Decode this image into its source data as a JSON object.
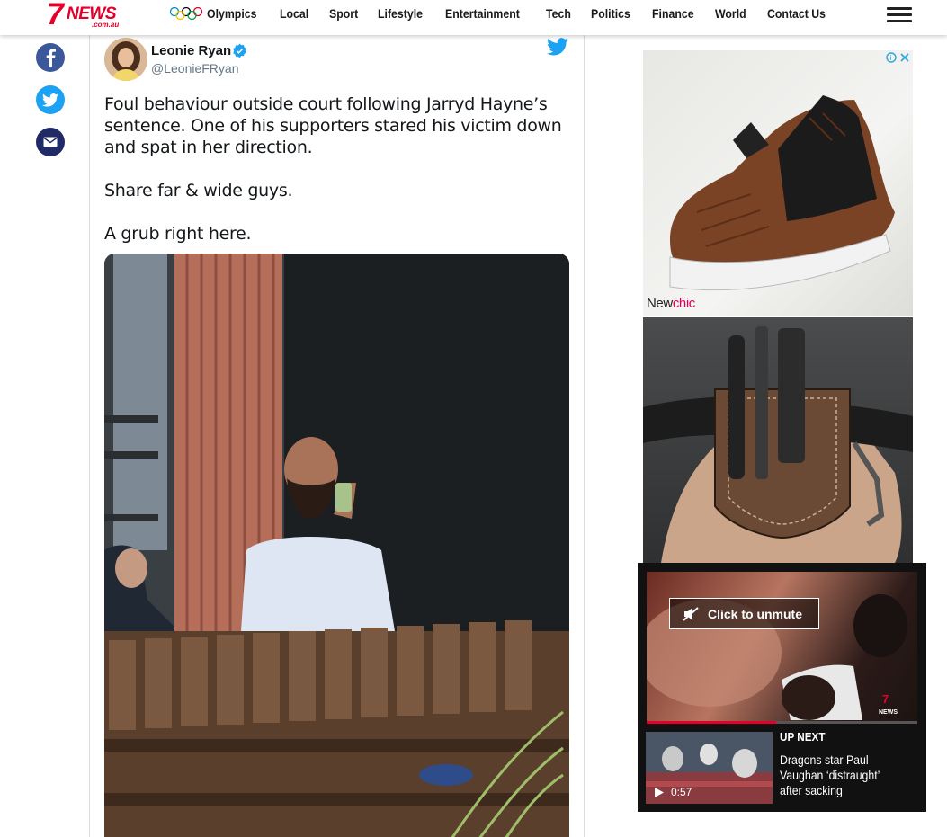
{
  "header": {
    "logo": {
      "seven": "7",
      "news": "NEWS",
      "sub": ".com.au"
    },
    "nav": [
      "Olympics",
      "Local",
      "Sport",
      "Lifestyle",
      "Entertainment",
      "Tech",
      "Politics",
      "Finance",
      "World",
      "Contact Us"
    ],
    "menu_icon": "hamburger-icon"
  },
  "share": {
    "icons": [
      "facebook-icon",
      "twitter-icon",
      "email-icon"
    ]
  },
  "tweet": {
    "author_name": "Leonie Ryan",
    "author_handle": "@LeonieFRyan",
    "text": [
      "Foul behaviour outside court following Jarryd Hayne’s sentence. One of his supporters stared his victim down and spat in her direction.",
      "Share far & wide guys.",
      "A grub right here."
    ]
  },
  "ads": {
    "ad1_brand_part1": "New",
    "ad1_brand_part2": "chic"
  },
  "video": {
    "unmute_label": "Click to unmute",
    "progress": 0.48,
    "up_next_label": "UP NEXT",
    "up_next_title": "Dragons star Paul Vaughan ‘distraught’ after sacking",
    "duration": "0:57"
  },
  "colors": {
    "brand_red": "#e4002b",
    "facebook": "#3b5998",
    "twitter": "#1da1f2",
    "email": "#1f2a66"
  }
}
